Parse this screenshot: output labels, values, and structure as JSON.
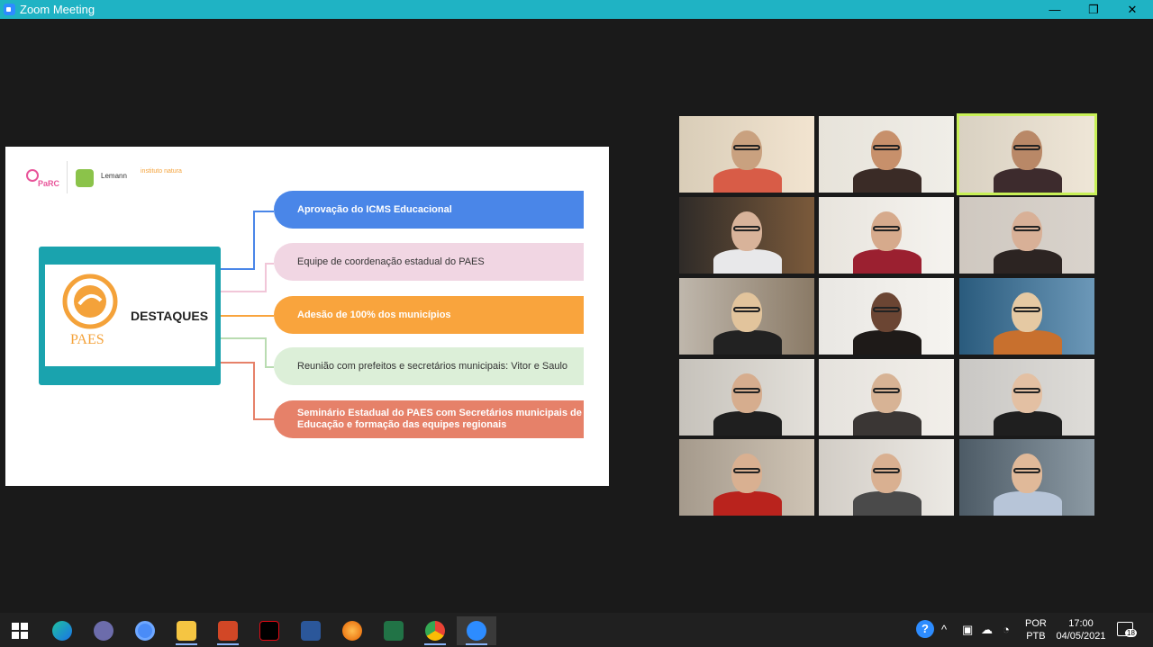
{
  "window": {
    "title": "Zoom Meeting",
    "minimize": "—",
    "restore": "❐",
    "close": "✕"
  },
  "slide": {
    "logos": {
      "lemann": "Lemann",
      "natura": "instituto natura",
      "parc": "PaRC"
    },
    "main_label": "DESTAQUES",
    "paes_logo_text": "PAES",
    "items": [
      "Aprovação do ICMS Educacional",
      "Equipe de coordenação estadual do PAES",
      "Adesão de 100% dos municípios",
      "Reunião com prefeitos e secretários municipais: Vitor e Saulo",
      "Seminário Estadual do PAES com Secretários municipais de Educação e formação das equipes regionais"
    ],
    "colors": [
      "#4a86e8",
      "#f1d6e3",
      "#f9a43d",
      "#dcefd8",
      "#e68169"
    ]
  },
  "participants": [
    {
      "id": 1,
      "active": false
    },
    {
      "id": 2,
      "active": false
    },
    {
      "id": 3,
      "active": true
    },
    {
      "id": 4,
      "active": false
    },
    {
      "id": 5,
      "active": false
    },
    {
      "id": 6,
      "active": false
    },
    {
      "id": 7,
      "active": false
    },
    {
      "id": 8,
      "active": false
    },
    {
      "id": 9,
      "active": false
    },
    {
      "id": 10,
      "active": false
    },
    {
      "id": 11,
      "active": false
    },
    {
      "id": 12,
      "active": false
    },
    {
      "id": 13,
      "active": false
    },
    {
      "id": 14,
      "active": false
    },
    {
      "id": 15,
      "active": false
    }
  ],
  "taskbar": {
    "apps": [
      "windows-start",
      "edge",
      "obs",
      "chrome-canary",
      "file-explorer",
      "powerpoint",
      "netflix",
      "word",
      "firefox",
      "excel",
      "chrome",
      "zoom"
    ],
    "lang_top": "POR",
    "lang_bottom": "PTB",
    "time": "17:00",
    "date": "04/05/2021",
    "notifications": "18"
  }
}
